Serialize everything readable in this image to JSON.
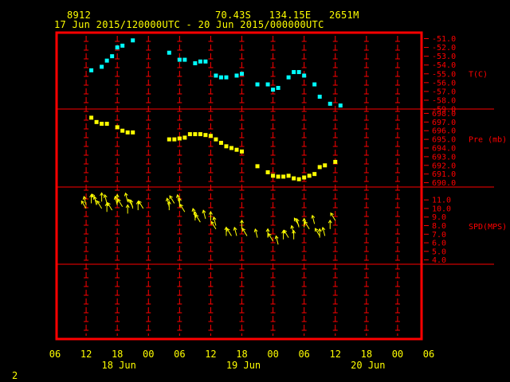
{
  "header": {
    "station": "8912",
    "location": "70.43S   134.15E   2651M",
    "period": "17 Jun 2015/120000UTC - 20 Jun 2015/000000UTC"
  },
  "page_number": "2",
  "colors": {
    "frame": "#ff0000",
    "axis_text": "#ff0000",
    "header_text": "#ffff00",
    "temperature": "#00ffff",
    "pressure": "#ffff00",
    "wind": "#ffff00"
  },
  "chart_data": {
    "type": "scatter",
    "grid": true,
    "x_axis": {
      "unit": "hours from 17 Jun 2015 06 UTC",
      "range": [
        0,
        72
      ],
      "tick_step": 6,
      "tick_labels": [
        "06",
        "12",
        "18",
        "00",
        "06",
        "12",
        "18",
        "00",
        "06",
        "12",
        "18",
        "00",
        "06"
      ],
      "date_labels": [
        {
          "x": 12,
          "text": "18 Jun"
        },
        {
          "x": 36,
          "text": "19 Jun"
        },
        {
          "x": 60,
          "text": "20 Jun"
        }
      ]
    },
    "panels": [
      {
        "key": "temperature",
        "label": "T(C)",
        "ylim": [
          -59,
          -50.5
        ],
        "ticks": [
          "-51.0",
          "-52.0",
          "-53.0",
          "-54.0",
          "-55.0",
          "-56.0",
          "-57.0",
          "-58.0",
          "-59.0"
        ],
        "series": [
          {
            "marker": "square",
            "color": "#00ffff",
            "x": [
              7,
              9,
              10,
              11,
              12,
              13,
              15,
              22,
              24,
              25,
              27,
              28,
              29,
              31,
              32,
              33,
              35,
              36,
              39,
              41,
              42,
              43,
              45,
              46,
              47,
              48,
              50,
              51,
              53,
              55
            ],
            "y": [
              -54.6,
              -54.2,
              -53.5,
              -53.0,
              -52.0,
              -51.8,
              -51.2,
              -52.6,
              -53.4,
              -53.4,
              -53.8,
              -53.6,
              -53.6,
              -55.2,
              -55.4,
              -55.4,
              -55.2,
              -55.0,
              -56.2,
              -56.2,
              -56.8,
              -56.6,
              -55.4,
              -54.8,
              -54.8,
              -55.2,
              -56.2,
              -57.6,
              -58.4,
              -58.6
            ]
          }
        ]
      },
      {
        "key": "pressure",
        "label": "Pre (mb)",
        "ylim": [
          689.5,
          698.5
        ],
        "ticks": [
          "698.0",
          "697.0",
          "696.0",
          "695.0",
          "694.0",
          "693.0",
          "692.0",
          "691.0",
          "690.0"
        ],
        "series": [
          {
            "marker": "square",
            "color": "#ffff00",
            "x": [
              7,
              8,
              9,
              10,
              12,
              13,
              14,
              15,
              22,
              23,
              24,
              25,
              26,
              27,
              28,
              29,
              30,
              31,
              32,
              33,
              34,
              35,
              36,
              39,
              41,
              42,
              43,
              44,
              45,
              46,
              47,
              48,
              49,
              50,
              51,
              52,
              54
            ],
            "y": [
              697.5,
              697.0,
              696.8,
              696.8,
              696.4,
              696.0,
              695.8,
              695.8,
              695.0,
              695.0,
              695.1,
              695.2,
              695.6,
              695.6,
              695.6,
              695.5,
              695.4,
              695.0,
              694.6,
              694.2,
              694.0,
              693.8,
              693.6,
              691.9,
              691.2,
              690.8,
              690.7,
              690.7,
              690.8,
              690.5,
              690.4,
              690.6,
              690.8,
              691.0,
              691.8,
              692.0,
              692.4
            ]
          }
        ]
      },
      {
        "key": "speed",
        "label": "SPD(MPS)",
        "ylim": [
          3.5,
          12.5
        ],
        "ticks": [
          "11.0",
          "10.0",
          "9.0",
          "8.0",
          "7.0",
          "6.0",
          "5.0",
          "4.0"
        ],
        "series": [
          {
            "marker": "arrow",
            "color": "#ffff00",
            "x": [
              6,
              6,
              7,
              8,
              8,
              9,
              9,
              10,
              10,
              11,
              12,
              12,
              13,
              14,
              14,
              15,
              15,
              16,
              17,
              22,
              22,
              23,
              24,
              24,
              25,
              27,
              27,
              28,
              29,
              30,
              31,
              31,
              33,
              34,
              35,
              36,
              37,
              39,
              41,
              42,
              43,
              44,
              45,
              46,
              46,
              47,
              47,
              48,
              49,
              50,
              51,
              51,
              52,
              53,
              54
            ],
            "y": [
              10.0,
              10.4,
              10.6,
              10.8,
              10.4,
              10.8,
              10.0,
              10.6,
              9.6,
              9.8,
              10.4,
              10.6,
              10.2,
              10.8,
              9.4,
              10.2,
              10.0,
              9.8,
              10.0,
              10.2,
              9.8,
              10.6,
              10.6,
              10.2,
              9.6,
              9.0,
              8.6,
              8.4,
              8.8,
              8.6,
              7.6,
              8.0,
              6.8,
              6.8,
              6.8,
              7.6,
              6.8,
              6.6,
              6.6,
              6.2,
              5.8,
              6.4,
              6.6,
              7.0,
              6.4,
              8.0,
              7.8,
              7.8,
              7.6,
              8.2,
              6.6,
              6.8,
              6.8,
              7.6,
              8.6
            ]
          }
        ]
      }
    ]
  }
}
